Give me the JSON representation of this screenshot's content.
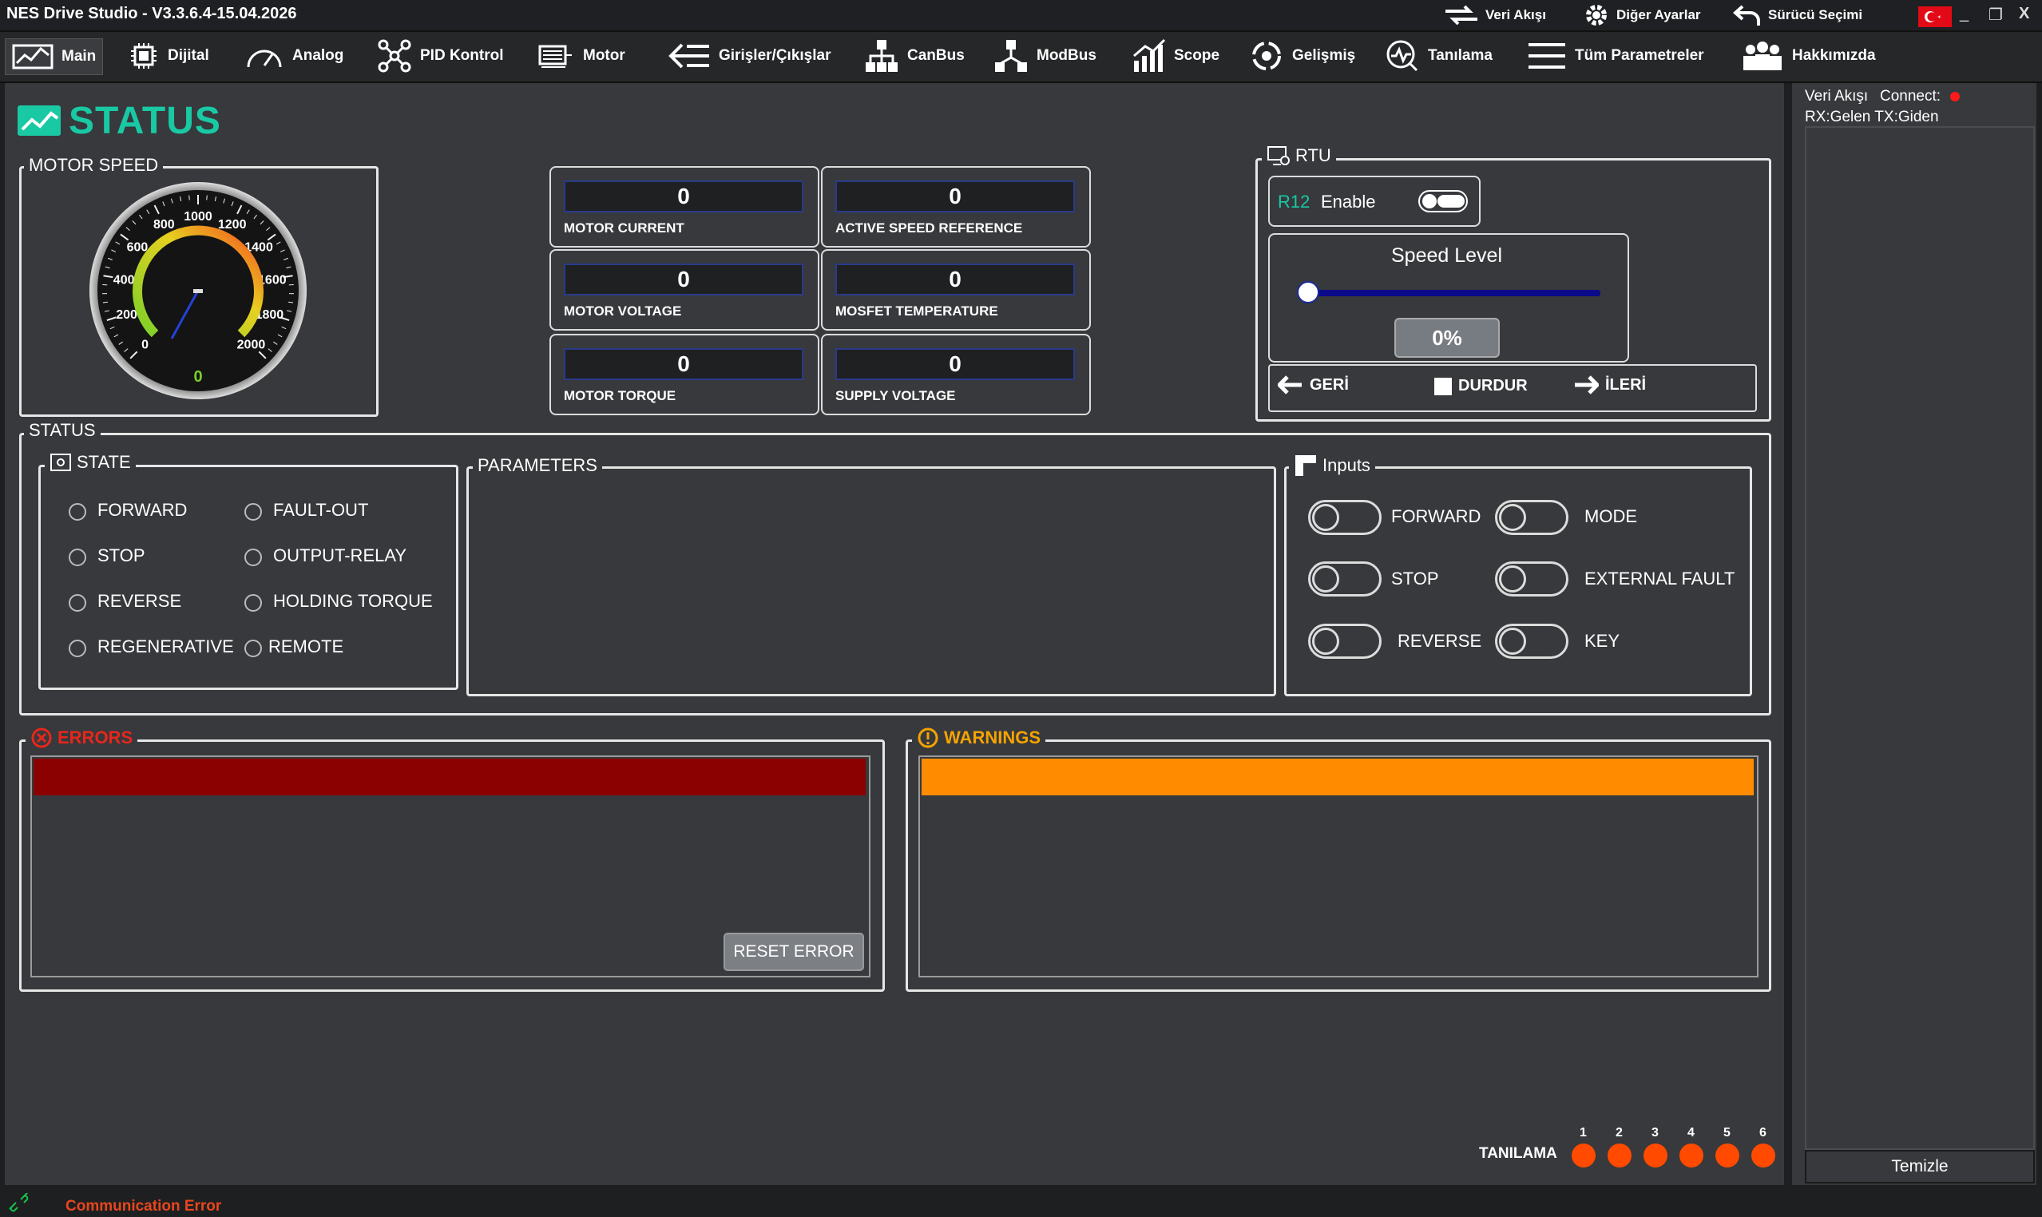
{
  "titlebar": {
    "title": "NES Drive Studio - V3.3.6.4-15.04.2026",
    "veri_akisi": "Veri Akışı",
    "diger_ayarlar": "Diğer Ayarlar",
    "surucu_secimi": "Sürücü Seçimi",
    "min": "_",
    "restore": "❐",
    "close": "X"
  },
  "nav": {
    "items": [
      {
        "label": "Main",
        "icon": "status-chart-icon"
      },
      {
        "label": "Dijital",
        "icon": "chip-icon"
      },
      {
        "label": "Analog",
        "icon": "gauge-icon"
      },
      {
        "label": "PID Kontrol",
        "icon": "network-icon"
      },
      {
        "label": "Motor",
        "icon": "motor-icon"
      },
      {
        "label": "Girişler/Çıkışlar",
        "icon": "arrow-left-icon"
      },
      {
        "label": "CanBus",
        "icon": "canbus-icon"
      },
      {
        "label": "ModBus",
        "icon": "modbus-icon"
      },
      {
        "label": "Scope",
        "icon": "scope-icon"
      },
      {
        "label": "Gelişmiş",
        "icon": "advanced-icon"
      },
      {
        "label": "Tanılama",
        "icon": "diagnostic-icon"
      },
      {
        "label": "Tüm Parametreler",
        "icon": "list-icon"
      },
      {
        "label": "Hakkımızda",
        "icon": "people-icon"
      }
    ]
  },
  "page": {
    "title": "STATUS"
  },
  "motor_speed": {
    "legend": "MOTOR SPEED",
    "ticks": [
      "0",
      "200",
      "400",
      "600",
      "800",
      "1000",
      "1200",
      "1400",
      "1600",
      "1800",
      "2000"
    ],
    "value": "0"
  },
  "tiles": [
    {
      "value": "0",
      "label": "MOTOR CURRENT"
    },
    {
      "value": "0",
      "label": "ACTIVE SPEED REFERENCE"
    },
    {
      "value": "0",
      "label": "MOTOR VOLTAGE"
    },
    {
      "value": "0",
      "label": "MOSFET TEMPERATURE"
    },
    {
      "value": "0",
      "label": "MOTOR TORQUE"
    },
    {
      "value": "0",
      "label": "SUPPLY VOLTAGE"
    }
  ],
  "rtu": {
    "legend": "RTU",
    "reg": "R12",
    "enable": "Enable",
    "speed_level": "Speed Level",
    "speed_percent": "0%",
    "speed_fraction": 0,
    "back": "GERİ",
    "stop": "DURDUR",
    "forward": "İLERİ"
  },
  "status": {
    "legend": "STATUS",
    "state_legend": "STATE",
    "states_left": [
      "FORWARD",
      "STOP",
      "REVERSE",
      "REGENERATIVE"
    ],
    "states_right": [
      "FAULT-OUT",
      "OUTPUT-RELAY",
      "HOLDING TORQUE",
      "REMOTE"
    ],
    "params_legend": "PARAMETERS",
    "inputs_legend": "Inputs",
    "inputs_left": [
      "FORWARD",
      "STOP",
      "REVERSE"
    ],
    "inputs_right": [
      "MODE",
      "EXTERNAL FAULT",
      "KEY"
    ]
  },
  "errors": {
    "legend": "ERRORS",
    "reset": "RESET ERROR",
    "color": "#8b0000"
  },
  "warnings": {
    "legend": "WARNINGS",
    "color": "#ff8c00"
  },
  "diag": {
    "label": "TANILAMA",
    "leds": [
      "1",
      "2",
      "3",
      "4",
      "5",
      "6"
    ]
  },
  "side": {
    "veri_akisi": "Veri Akışı",
    "connect": "Connect:",
    "rxtx": "RX:Gelen TX:Giden",
    "clear": "Temizle"
  },
  "statusbar": {
    "message": "Communication Error"
  }
}
